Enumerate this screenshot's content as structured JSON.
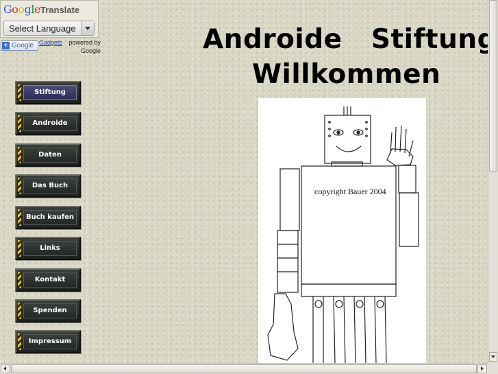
{
  "translate_widget": {
    "google_letters": [
      "G",
      "o",
      "o",
      "g",
      "l",
      "e"
    ],
    "google_colors": [
      "#2a5bd7",
      "#d62d20",
      "#f0b400",
      "#2a5bd7",
      "#0e8c3a",
      "#d62d20"
    ],
    "translate_label": "Translate",
    "select_label": "Select Language",
    "google_button_label": "Google",
    "gadgets_link": "Gadgets",
    "powered_by": "powered by",
    "powered_google": "Google"
  },
  "nav": {
    "items": [
      {
        "label": "Stiftung",
        "active": true
      },
      {
        "label": "Androide",
        "active": false
      },
      {
        "label": "Daten",
        "active": false
      },
      {
        "label": "Das Buch",
        "active": false
      },
      {
        "label": "Buch kaufen",
        "active": false
      },
      {
        "label": "Links",
        "active": false
      },
      {
        "label": "Kontakt",
        "active": false
      },
      {
        "label": "Spenden",
        "active": false
      },
      {
        "label": "Impressum",
        "active": false
      }
    ]
  },
  "header": {
    "title_line1": "Androide   Stiftung",
    "title_line2": "Willkommen"
  },
  "robot_image": {
    "copyright": "copyright Bauer 2004"
  },
  "colors": {
    "background": "#d9d6c4",
    "nav_button": "#2a2e2a",
    "nav_active": "#3a3a66",
    "stripe_yellow": "#e6c21b"
  }
}
